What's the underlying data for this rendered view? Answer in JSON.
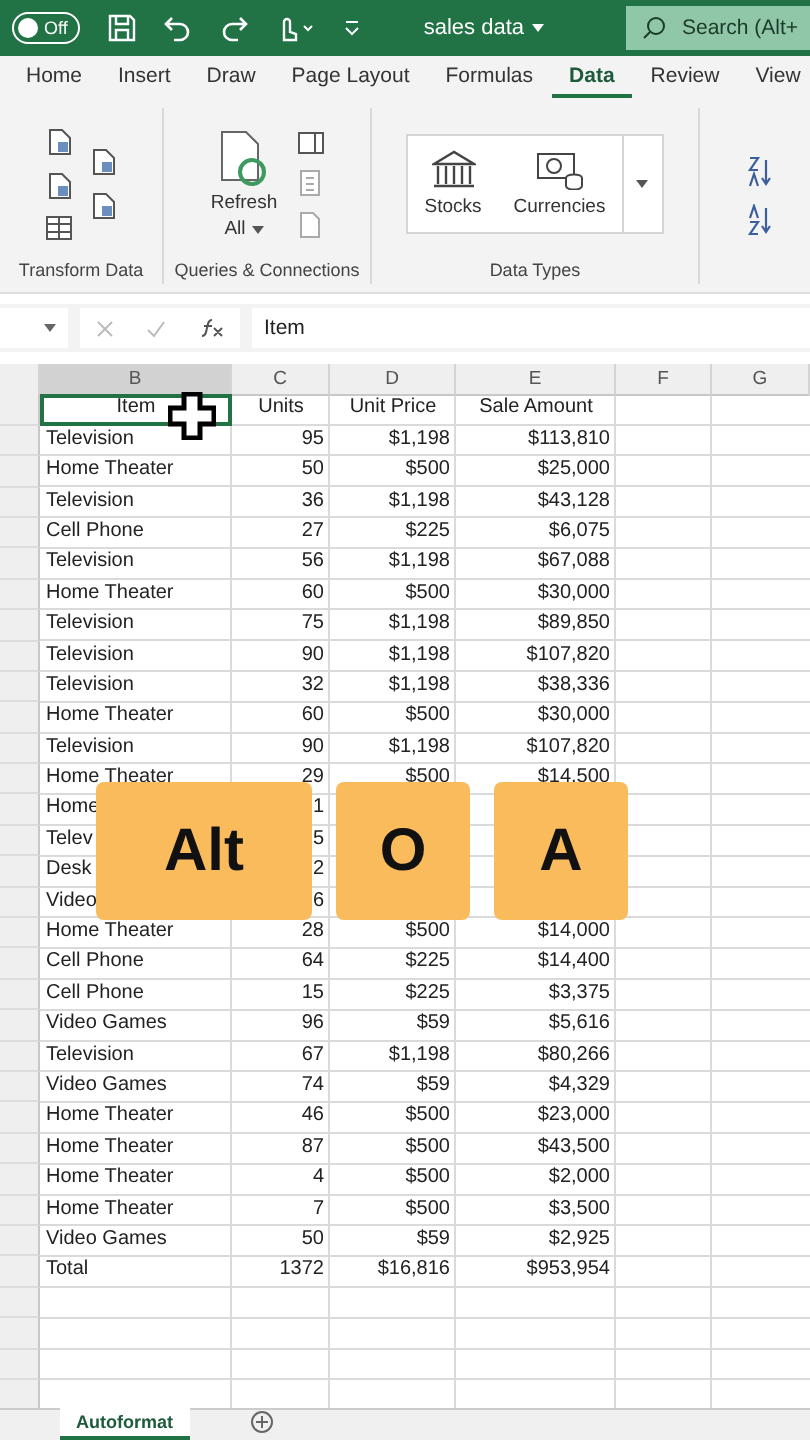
{
  "title_bar": {
    "autosave": {
      "label": "Off",
      "on": false
    },
    "file_name": "sales data",
    "search": {
      "placeholder": "Search (Alt+"
    }
  },
  "tabs": [
    {
      "label": "Home",
      "selected": false
    },
    {
      "label": "Insert",
      "selected": false
    },
    {
      "label": "Draw",
      "selected": false
    },
    {
      "label": "Page Layout",
      "selected": false
    },
    {
      "label": "Formulas",
      "selected": false
    },
    {
      "label": "Data",
      "selected": true
    },
    {
      "label": "Review",
      "selected": false
    },
    {
      "label": "View",
      "selected": false
    }
  ],
  "ribbon": {
    "groups": [
      {
        "label": "Transform Data"
      },
      {
        "label": "Queries & Connections",
        "refresh": "Refresh",
        "refresh_all": "All"
      },
      {
        "label": "Data Types",
        "types": [
          "Stocks",
          "Currencies"
        ]
      }
    ]
  },
  "formula_bar": {
    "value": "Item"
  },
  "columns": [
    {
      "letter": "B",
      "selected": true
    },
    {
      "letter": "C",
      "selected": false
    },
    {
      "letter": "D",
      "selected": false
    },
    {
      "letter": "E",
      "selected": false
    },
    {
      "letter": "F",
      "selected": false
    },
    {
      "letter": "G",
      "selected": false
    }
  ],
  "header_row": [
    {
      "text": "Item",
      "selected": true
    },
    {
      "text": "Units",
      "selected": false
    },
    {
      "text": "Unit Price",
      "selected": false
    },
    {
      "text": "Sale Amount",
      "selected": false
    }
  ],
  "rows": [
    [
      "Television",
      "95",
      "$1,198",
      "$113,810"
    ],
    [
      "Home Theater",
      "50",
      "$500",
      "$25,000"
    ],
    [
      "Television",
      "36",
      "$1,198",
      "$43,128"
    ],
    [
      "Cell Phone",
      "27",
      "$225",
      "$6,075"
    ],
    [
      "Television",
      "56",
      "$1,198",
      "$67,088"
    ],
    [
      "Home Theater",
      "60",
      "$500",
      "$30,000"
    ],
    [
      "Television",
      "75",
      "$1,198",
      "$89,850"
    ],
    [
      "Television",
      "90",
      "$1,198",
      "$107,820"
    ],
    [
      "Television",
      "32",
      "$1,198",
      "$38,336"
    ],
    [
      "Home Theater",
      "60",
      "$500",
      "$30,000"
    ],
    [
      "Television",
      "90",
      "$1,198",
      "$107,820"
    ],
    [
      "Home Theater",
      "29",
      "$500",
      "$14,500"
    ],
    [
      "Home",
      "1"
    ],
    [
      "Telev",
      "5"
    ],
    [
      "Desk",
      "2"
    ],
    [
      "Video",
      "6"
    ],
    [
      "Home Theater",
      "28",
      "$500",
      "$14,000"
    ],
    [
      "Cell Phone",
      "64",
      "$225",
      "$14,400"
    ],
    [
      "Cell Phone",
      "15",
      "$225",
      "$3,375"
    ],
    [
      "Video Games",
      "96",
      "$59",
      "$5,616"
    ],
    [
      "Television",
      "67",
      "$1,198",
      "$80,266"
    ],
    [
      "Video Games",
      "74",
      "$59",
      "$4,329"
    ],
    [
      "Home Theater",
      "46",
      "$500",
      "$23,000"
    ],
    [
      "Home Theater",
      "87",
      "$500",
      "$43,500"
    ],
    [
      "Home Theater",
      "4",
      "$500",
      "$2,000"
    ],
    [
      "Home Theater",
      "7",
      "$500",
      "$3,500"
    ],
    [
      "Video Games",
      "50",
      "$59",
      "$2,925"
    ],
    [
      "Total",
      "1372",
      "$16,816",
      "$953,954"
    ]
  ],
  "key_overlay": [
    "Alt",
    "O",
    "A"
  ],
  "sheet_tabs": [
    {
      "label": "Autoformat",
      "selected": true
    }
  ]
}
